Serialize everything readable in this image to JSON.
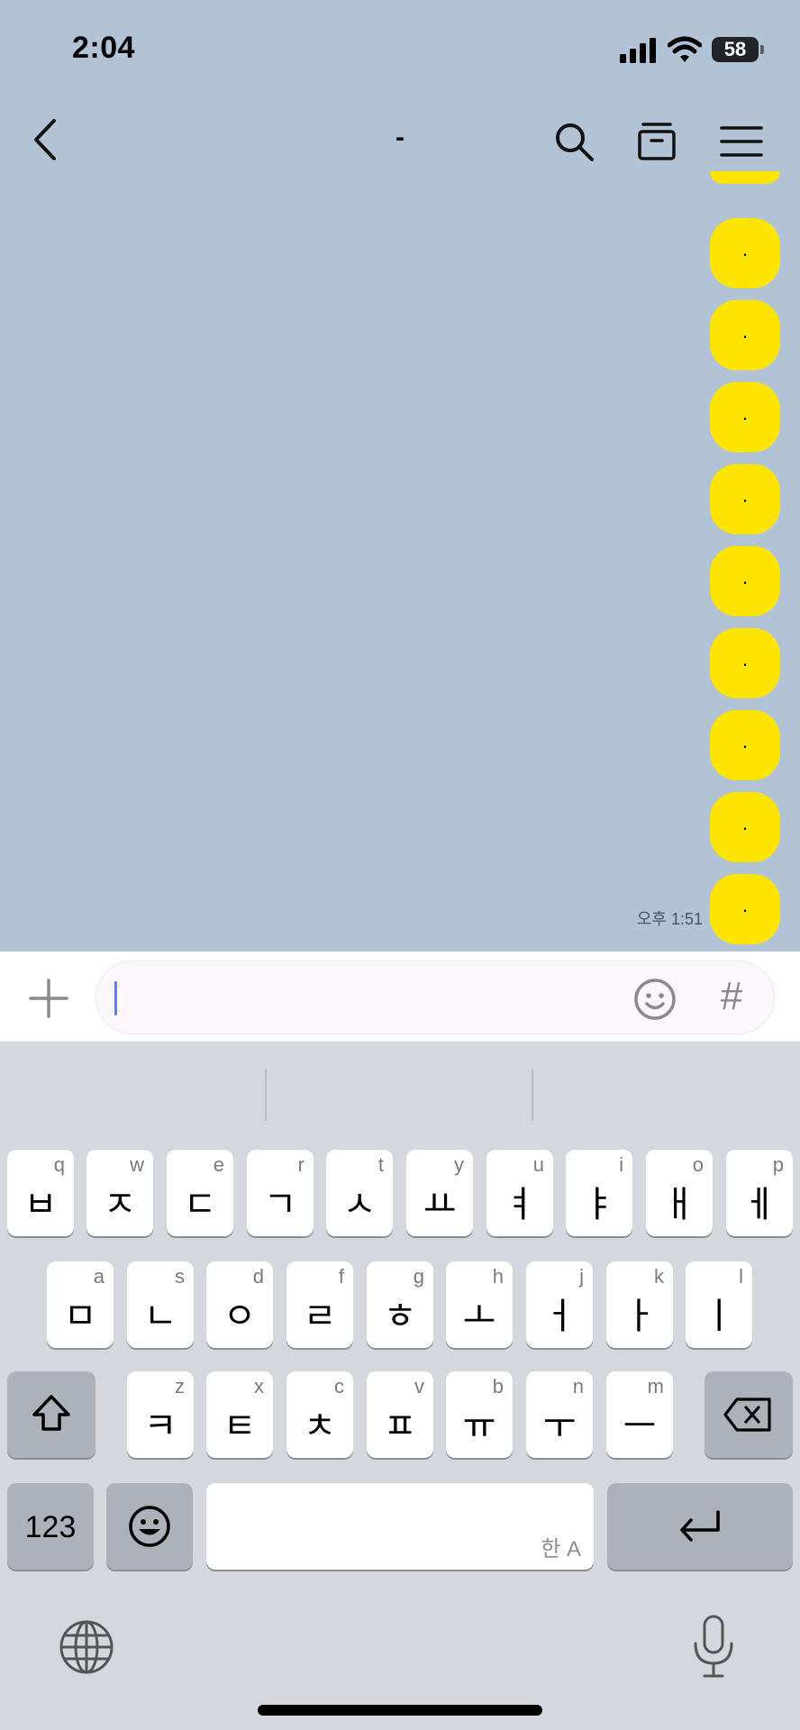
{
  "status_bar": {
    "time": "2:04",
    "battery": "58"
  },
  "nav": {
    "title": "-"
  },
  "chat": {
    "bubbles": [
      ".",
      ".",
      ".",
      ".",
      ".",
      ".",
      ".",
      ".",
      ".",
      "."
    ],
    "last_time": "오후 1:51",
    "bubble_color": "#fee500",
    "background_color": "#b2c3d6"
  },
  "input": {
    "hash": "#"
  },
  "keyboard": {
    "row1": [
      {
        "hint": "q",
        "char": "ㅂ"
      },
      {
        "hint": "w",
        "char": "ㅈ"
      },
      {
        "hint": "e",
        "char": "ㄷ"
      },
      {
        "hint": "r",
        "char": "ㄱ"
      },
      {
        "hint": "t",
        "char": "ㅅ"
      },
      {
        "hint": "y",
        "char": "ㅛ"
      },
      {
        "hint": "u",
        "char": "ㅕ"
      },
      {
        "hint": "i",
        "char": "ㅑ"
      },
      {
        "hint": "o",
        "char": "ㅐ"
      },
      {
        "hint": "p",
        "char": "ㅔ"
      }
    ],
    "row2": [
      {
        "hint": "a",
        "char": "ㅁ"
      },
      {
        "hint": "s",
        "char": "ㄴ"
      },
      {
        "hint": "d",
        "char": "ㅇ"
      },
      {
        "hint": "f",
        "char": "ㄹ"
      },
      {
        "hint": "g",
        "char": "ㅎ"
      },
      {
        "hint": "h",
        "char": "ㅗ"
      },
      {
        "hint": "j",
        "char": "ㅓ"
      },
      {
        "hint": "k",
        "char": "ㅏ"
      },
      {
        "hint": "l",
        "char": "ㅣ"
      }
    ],
    "row3": [
      {
        "hint": "z",
        "char": "ㅋ"
      },
      {
        "hint": "x",
        "char": "ㅌ"
      },
      {
        "hint": "c",
        "char": "ㅊ"
      },
      {
        "hint": "v",
        "char": "ㅍ"
      },
      {
        "hint": "b",
        "char": "ㅠ"
      },
      {
        "hint": "n",
        "char": "ㅜ"
      },
      {
        "hint": "m",
        "char": "ㅡ"
      }
    ],
    "numbers_label": "123",
    "space_label": "한 A"
  }
}
